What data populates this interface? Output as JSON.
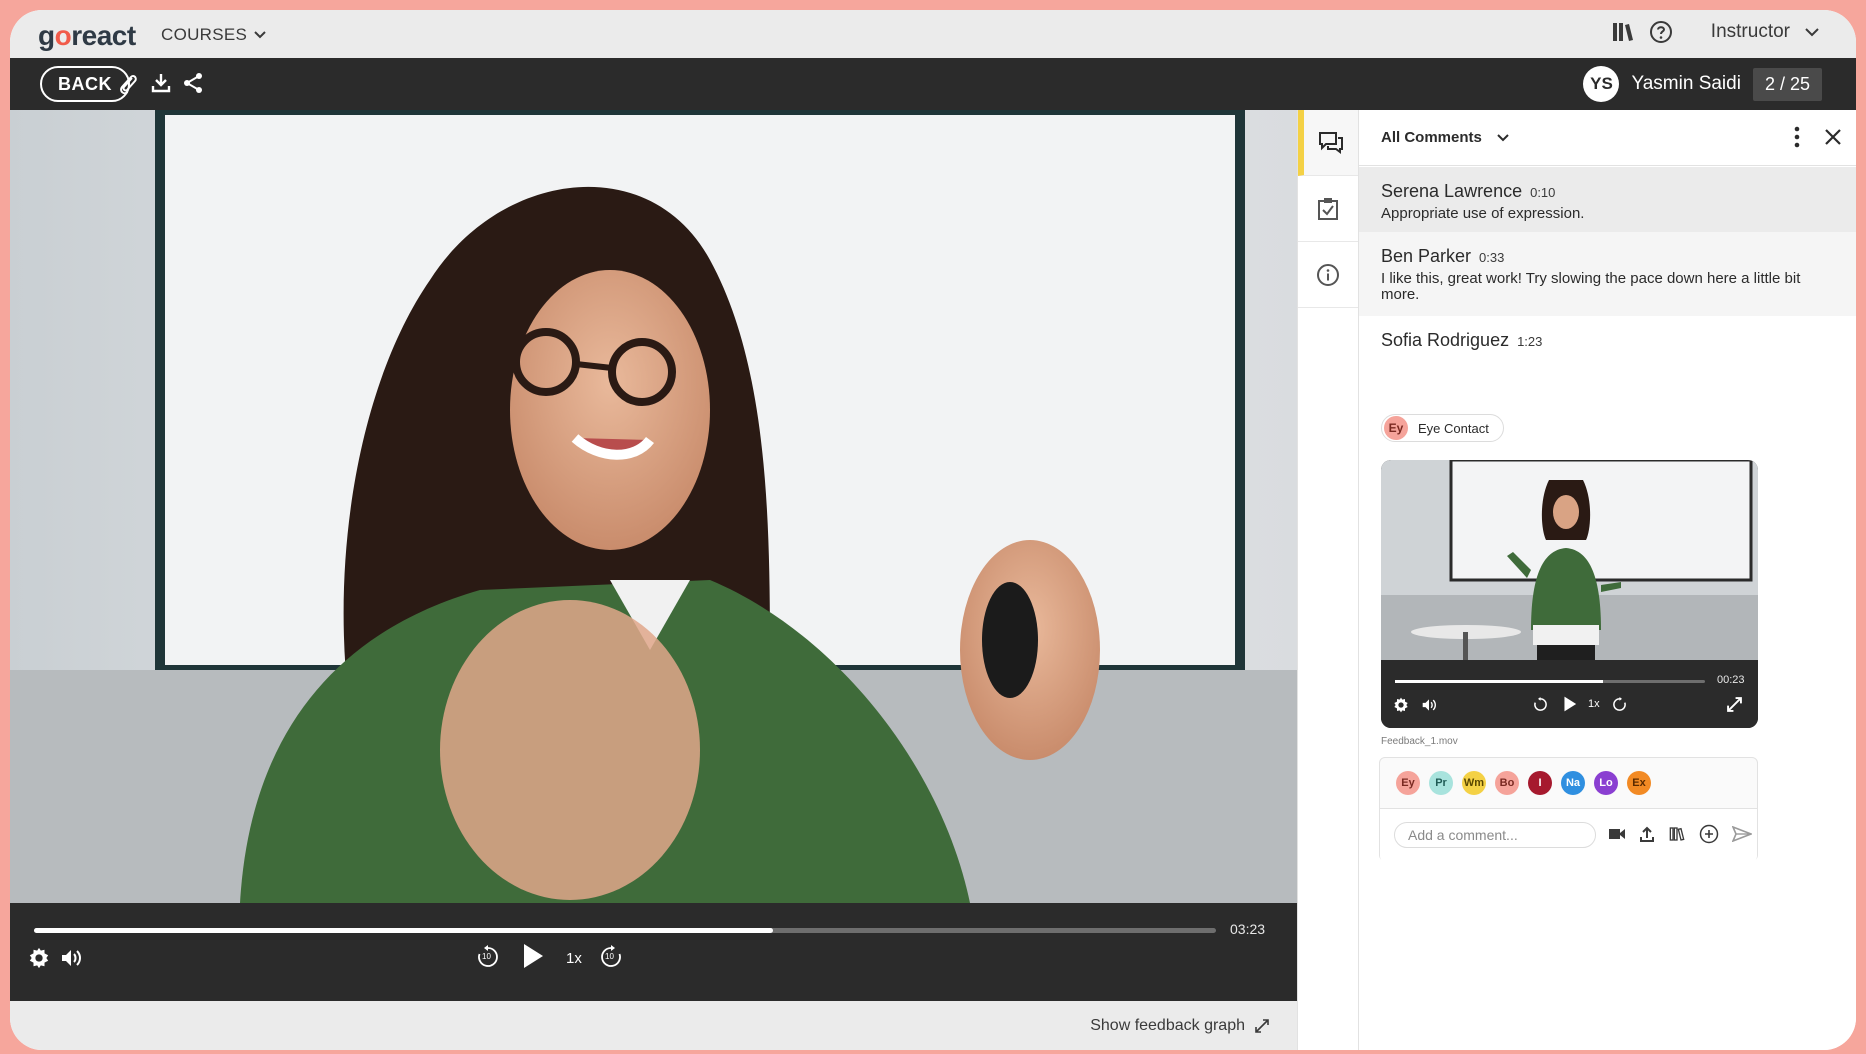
{
  "app": {
    "logo_prefix": "g",
    "logo_o": "o",
    "logo_suffix": "react",
    "courses_label": "COURSES",
    "role_label": "Instructor"
  },
  "toolbar": {
    "back_label": "BACK",
    "user_initials": "YS",
    "user_name": "Yasmin Saidi",
    "counter": "2 / 25"
  },
  "player": {
    "duration": "03:23",
    "progress": 0.625,
    "speed": "1x",
    "skip_back": "10",
    "skip_forward": "10",
    "feedback_graph_label": "Show feedback graph"
  },
  "panel": {
    "filter_label": "All Comments",
    "comments": [
      {
        "author": "Serena Lawrence",
        "time": "0:10",
        "text": "Appropriate use of expression."
      },
      {
        "author": "Ben Parker",
        "time": "0:33",
        "text": "I like this, great work! Try slowing the pace down here a little bit more."
      },
      {
        "author": "Sofia Rodriguez",
        "time": "1:23",
        "text": ""
      }
    ],
    "tag": {
      "abbr": "Ey",
      "label": "Eye Contact",
      "color": "#f5a39a"
    },
    "attachment": {
      "time": "00:23",
      "progress": 0.67,
      "speed": "1x",
      "filename": "Feedback_1.mov"
    },
    "markers": [
      {
        "abbr": "Ey",
        "color": "#f5a39a",
        "text_color": "#7a2a22"
      },
      {
        "abbr": "Pr",
        "color": "#a8e3dd",
        "text_color": "#1f5b55"
      },
      {
        "abbr": "Wm",
        "color": "#f4d145",
        "text_color": "#5a4700"
      },
      {
        "abbr": "Bo",
        "color": "#f5a39a",
        "text_color": "#7a2a22"
      },
      {
        "abbr": "I",
        "color": "#a6192e",
        "text_color": "#ffffff"
      },
      {
        "abbr": "Na",
        "color": "#2f8fe0",
        "text_color": "#ffffff"
      },
      {
        "abbr": "Lo",
        "color": "#8a3fd1",
        "text_color": "#ffffff"
      },
      {
        "abbr": "Ex",
        "color": "#f28a24",
        "text_color": "#5a2a00"
      }
    ],
    "comment_placeholder": "Add a comment..."
  },
  "colors": {
    "accent_yellow": "#f4d145",
    "frame": "#f6a69c",
    "toolbar": "#2b2b2b"
  }
}
